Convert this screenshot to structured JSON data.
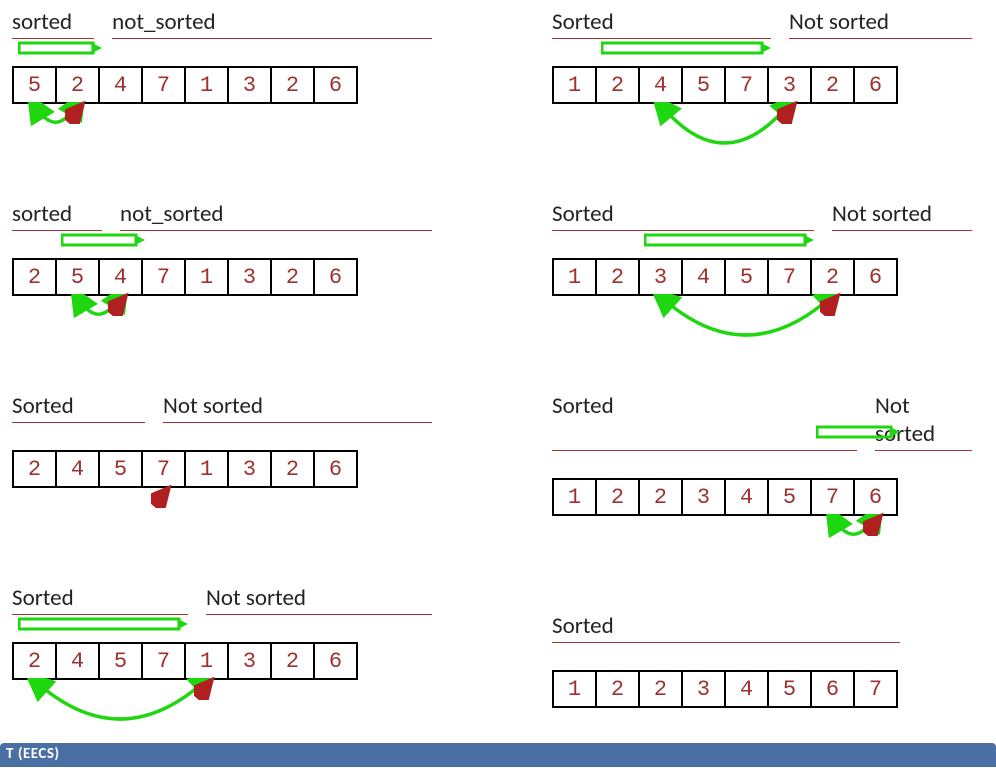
{
  "chart_data": {
    "type": "table",
    "description": "Insertion sort step-by-step, left column steps 1-4, right column steps 5-8",
    "initial": [
      5,
      2,
      4,
      7,
      1,
      3,
      2,
      6
    ],
    "final": [
      1,
      2,
      2,
      3,
      4,
      5,
      6,
      7
    ],
    "steps": [
      {
        "sorted_label": "sorted",
        "not_sorted_label": "not_sorted",
        "array": [
          5,
          2,
          4,
          7,
          1,
          3,
          2,
          6
        ],
        "sorted_count": 1,
        "h_arrow": {
          "start": 0,
          "end": 2
        },
        "swap": {
          "from": 0,
          "to": 1
        },
        "red_idx": 1
      },
      {
        "sorted_label": "sorted",
        "not_sorted_label": "not_sorted",
        "array": [
          2,
          5,
          4,
          7,
          1,
          3,
          2,
          6
        ],
        "sorted_count": 2,
        "h_arrow": {
          "start": 1,
          "end": 3
        },
        "swap": {
          "from": 1,
          "to": 2
        },
        "red_idx": 2
      },
      {
        "sorted_label": "Sorted",
        "not_sorted_label": "Not sorted",
        "array": [
          2,
          4,
          5,
          7,
          1,
          3,
          2,
          6
        ],
        "sorted_count": 3,
        "h_arrow": null,
        "swap": null,
        "red_idx": 3
      },
      {
        "sorted_label": "Sorted",
        "not_sorted_label": "Not sorted",
        "array": [
          2,
          4,
          5,
          7,
          1,
          3,
          2,
          6
        ],
        "sorted_count": 4,
        "h_arrow": {
          "start": 0,
          "end": 4
        },
        "swap": {
          "from": 0,
          "to": 4
        },
        "red_idx": 4
      },
      {
        "sorted_label": "Sorted",
        "not_sorted_label": "Not sorted",
        "array": [
          1,
          2,
          4,
          5,
          7,
          3,
          2,
          6
        ],
        "sorted_count": 5,
        "h_arrow": {
          "start": 1,
          "end": 5
        },
        "swap": {
          "from": 2,
          "to": 5
        },
        "red_idx": 5
      },
      {
        "sorted_label": "Sorted",
        "not_sorted_label": "Not sorted",
        "array": [
          1,
          2,
          3,
          4,
          5,
          7,
          2,
          6
        ],
        "sorted_count": 6,
        "h_arrow": {
          "start": 2,
          "end": 6
        },
        "swap": {
          "from": 2,
          "to": 6
        },
        "red_idx": 6
      },
      {
        "sorted_label": "Sorted",
        "not_sorted_label": "Not sorted",
        "array": [
          1,
          2,
          2,
          3,
          4,
          5,
          7,
          6
        ],
        "sorted_count": 7,
        "h_arrow": {
          "start": 6,
          "end": 8
        },
        "swap": {
          "from": 6,
          "to": 7
        },
        "red_idx": 7
      },
      {
        "sorted_label": "Sorted",
        "not_sorted_label": "",
        "array": [
          1,
          2,
          2,
          3,
          4,
          5,
          6,
          7
        ],
        "sorted_count": 8,
        "h_arrow": null,
        "swap": null,
        "red_idx": null
      }
    ]
  },
  "footer_text": "T (EECS)"
}
